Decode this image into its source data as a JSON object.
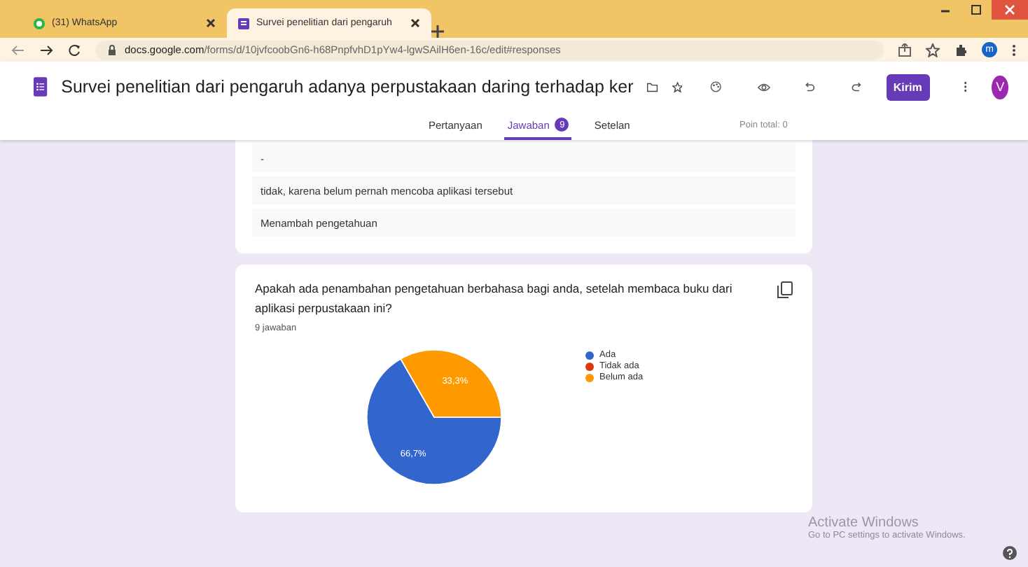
{
  "browser": {
    "tabs": [
      {
        "title": "(31) WhatsApp",
        "selected": false
      },
      {
        "title": "Survei penelitian dari pengaruh",
        "selected": true
      }
    ],
    "url_domain": "docs.google.com",
    "url_path": "/forms/d/10jvfcoobGn6-h68PnpfvhD1pYw4-lgwSAilH6en-16c/edit#responses",
    "profile": "m"
  },
  "form": {
    "title": "Survei penelitian dari pengaruh adanya perpustakaan daring terhadap ker",
    "send_button": "Kirim",
    "avatar": "V",
    "tabs": [
      {
        "label": "Pertanyaan",
        "selected": false
      },
      {
        "label": "Jawaban",
        "selected": true,
        "badge": "9"
      },
      {
        "label": "Setelan",
        "selected": false
      }
    ],
    "points": "Poin total: 0"
  },
  "answers": [
    "-",
    "tidak, karena belum pernah mencoba aplikasi tersebut",
    "Menambah pengetahuan"
  ],
  "question": {
    "title": "Apakah ada penambahan pengetahuan berbahasa bagi anda, setelah membaca buku dari aplikasi perpustakaan ini?",
    "count": "9 jawaban",
    "legend": [
      {
        "color": "#3366cc"
      },
      {
        "color": "#dc3912"
      },
      {
        "color": "#ff9900"
      }
    ],
    "chart_data": {
      "type": "pie",
      "categories": [
        "Ada",
        "Tidak ada",
        "Belum ada"
      ],
      "series": [
        {
          "values": [
            66.7,
            0,
            33.3
          ]
        }
      ],
      "value_labels": [
        "66,7%",
        null,
        "33,3%"
      ]
    }
  },
  "os_overlay": {
    "title": "Activate Windows",
    "text": "Go to PC settings to activate Windows."
  }
}
